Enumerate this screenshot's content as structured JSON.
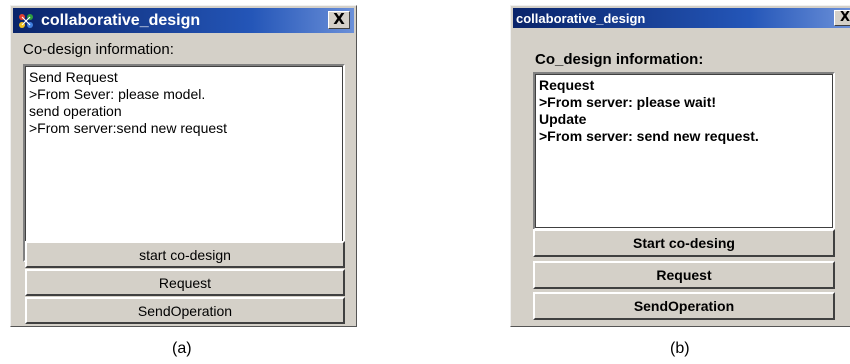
{
  "window_a": {
    "title": "collaborative_design",
    "close_label": "X",
    "info_label": "Co-design information:",
    "log_lines": [
      "Send Request",
      ">From Sever: please model.",
      "send operation",
      ">From server:send new request"
    ],
    "buttons": {
      "start": "start co-design",
      "request": "Request",
      "send_operation": "SendOperation"
    },
    "caption": "(a)"
  },
  "window_b": {
    "title": "collaborative_design",
    "close_label": "X",
    "info_label": "Co_design information:",
    "log_lines": [
      "Request",
      ">From server: please wait!",
      "Update",
      ">From server: send new request."
    ],
    "buttons": {
      "start": "Start co-desing",
      "request": "Request",
      "send_operation": "SendOperation"
    },
    "caption": "(b)"
  },
  "colors": {
    "title_bar": "#0a246a",
    "window_face": "#d4d0c8",
    "log_background": "#ffffff"
  },
  "icons": {
    "app": "collaboration-icon",
    "close": "close-icon"
  }
}
